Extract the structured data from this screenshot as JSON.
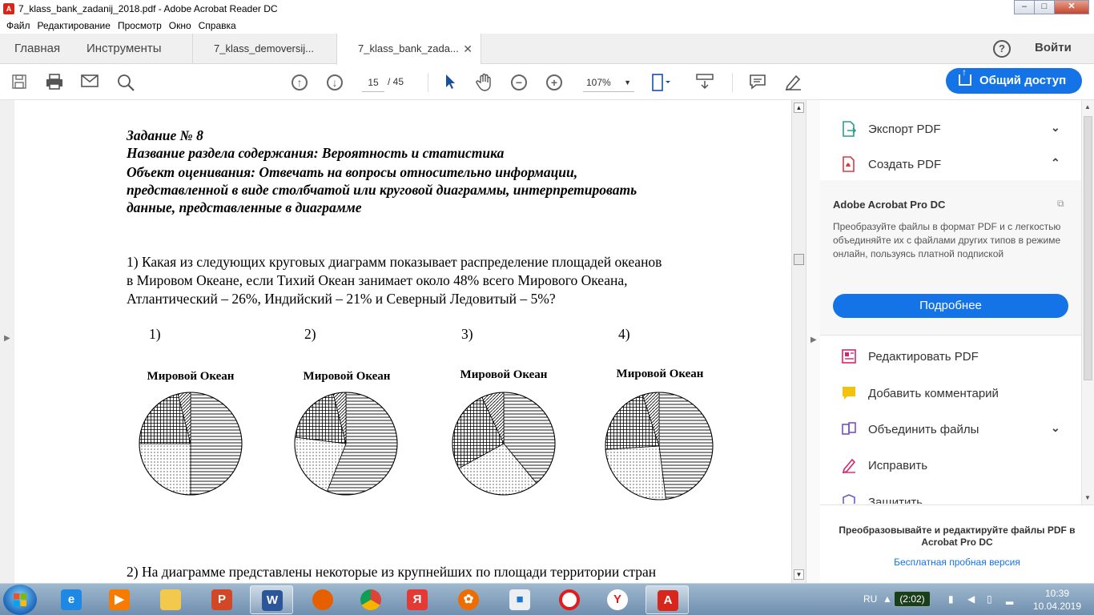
{
  "window": {
    "title": "7_klass_bank_zadanij_2018.pdf - Adobe Acrobat Reader DC",
    "controls": [
      "–",
      "□",
      "✕"
    ]
  },
  "menu": [
    "Файл",
    "Редактирование",
    "Просмотр",
    "Окно",
    "Справка"
  ],
  "tabs": {
    "home": "Главная",
    "tools": "Инструменты",
    "doc1": "7_klass_demoversij...",
    "doc2": "7_klass_bank_zada...",
    "close": "✕"
  },
  "header": {
    "help": "?",
    "signin": "Войти"
  },
  "toolbar": {
    "page_current": "15",
    "page_total": "/ 45",
    "zoom": "107%",
    "share_label": "Общий доступ"
  },
  "document": {
    "task_lines": [
      "Задание № 8",
      "Название раздела содержания: Вероятность и статистика",
      "Объект оценивания: Отвечать на вопросы относительно информации,",
      "представленной в виде столбчатой или круговой диаграммы, интерпретировать",
      "данные, представленные в диаграмме"
    ],
    "question1_lines": [
      "1) Какая из следующих круговых диаграмм показывает распределение площадей океанов",
      "в Мировом Океане, если Тихий Океан занимает около 48% всего Мирового Океана,",
      "Атлантический – 26%, Индийский – 21% и Северный Ледовитый – 5%?"
    ],
    "options": [
      "1)",
      "2)",
      "3)",
      "4)"
    ],
    "pie_title": "Мировой Океан",
    "question2": "2) На диаграмме представлены некоторые из крупнейших по площади территории стран"
  },
  "chart_data": [
    {
      "type": "pie",
      "title": "Мировой Океан",
      "values": [
        50,
        25,
        21,
        4
      ]
    },
    {
      "type": "pie",
      "title": "Мировой Океан",
      "values": [
        56,
        21,
        19,
        4
      ]
    },
    {
      "type": "pie",
      "title": "Мировой Океан",
      "values": [
        39,
        28,
        26,
        7
      ]
    },
    {
      "type": "pie",
      "title": "Мировой Океан",
      "values": [
        48,
        26,
        21,
        5
      ]
    }
  ],
  "right_pane": {
    "export_pdf": "Экспорт PDF",
    "create_pdf": "Создать PDF",
    "promo_title": "Adobe Acrobat Pro DC",
    "promo_text": "Преобразуйте файлы в формат PDF и с легкостью объединяйте их с файлами других типов в режиме онлайн, пользуясь платной подпиской",
    "more_button": "Подробнее",
    "edit_pdf": "Редактировать PDF",
    "add_comment": "Добавить комментарий",
    "combine_files": "Объединить файлы",
    "fill_sign": "Исправить",
    "protect": "Защитить",
    "bottom_text": "Преобразовывайте и редактируйте файлы PDF в Acrobat Pro DC",
    "trial_link": "Бесплатная пробная версия"
  },
  "taskbar": {
    "lang": "RU",
    "battery": "(2:02)",
    "time": "10:39",
    "date": "10.04.2019"
  },
  "colors": {
    "accent": "#1473e6",
    "title_red": "#d9261c"
  }
}
